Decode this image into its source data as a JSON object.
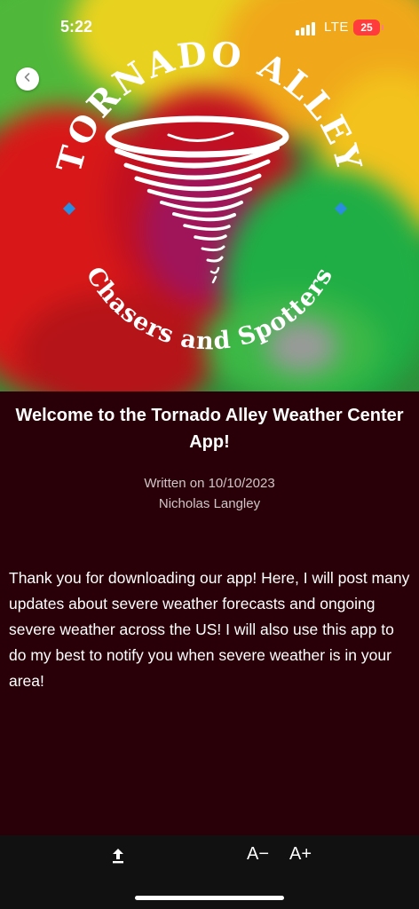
{
  "status_bar": {
    "time": "5:22",
    "network": "LTE",
    "battery": "25"
  },
  "logo": {
    "top_text": "TORNADO ALLEY",
    "bottom_text": "Chasers and Spotters"
  },
  "article": {
    "title": "Welcome to the Tornado Alley Weather Center App!",
    "written_on": "Written on 10/10/2023",
    "author": "Nicholas Langley",
    "body": "Thank you for downloading our app! Here, I will post many updates about severe weather forecasts and ongoing severe weather across the US! I will also use this app to do my best to notify you when severe weather is in your area!"
  },
  "toolbar": {
    "decrease_font": "A−",
    "increase_font": "A+"
  },
  "icons": {
    "back": "chevron-left-icon",
    "share": "share-upload-icon"
  },
  "colors": {
    "background": "#2a0008",
    "toolbar": "#111111",
    "battery": "#ff3b3b"
  }
}
